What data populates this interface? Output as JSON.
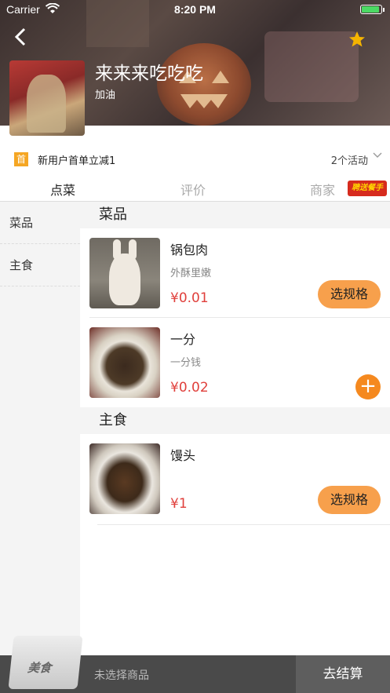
{
  "status_bar": {
    "carrier": "Carrier",
    "time": "8:20 PM",
    "battery_level": 0.9,
    "wifi_icon": "wifi-icon"
  },
  "header": {
    "back_icon": "chevron-left-icon",
    "favorite_icon": "star-icon",
    "shop_name": "来来来吃吃吃",
    "shop_tagline": "加油"
  },
  "promo": {
    "badge": "首",
    "text": "新用户首单立减1",
    "activities": "2个活动"
  },
  "tabs": [
    {
      "label": "点菜",
      "active": true
    },
    {
      "label": "评价",
      "active": false
    },
    {
      "label": "商家",
      "active": false
    }
  ],
  "recruit_badge": "聘送餐手",
  "sidebar": {
    "items": [
      {
        "label": "菜品"
      },
      {
        "label": "主食"
      }
    ]
  },
  "sections": [
    {
      "title": "菜品",
      "dishes": [
        {
          "name": "锅包肉",
          "desc": "外酥里嫩",
          "price": "¥0.01",
          "action": "选规格"
        },
        {
          "name": "一分",
          "desc": "一分钱",
          "price": "¥0.02",
          "action": "+"
        }
      ]
    },
    {
      "title": "主食",
      "dishes": [
        {
          "name": "馒头",
          "desc": "",
          "price": "¥1",
          "action": "选规格"
        }
      ]
    }
  ],
  "cart": {
    "logo_text": "美食",
    "hint": "未选择商品",
    "checkout": "去结算"
  },
  "colors": {
    "accent": "#f7a04c",
    "price": "#e0403c",
    "add_button": "#f5891f",
    "bottom_bar": "#4a4a4a"
  }
}
